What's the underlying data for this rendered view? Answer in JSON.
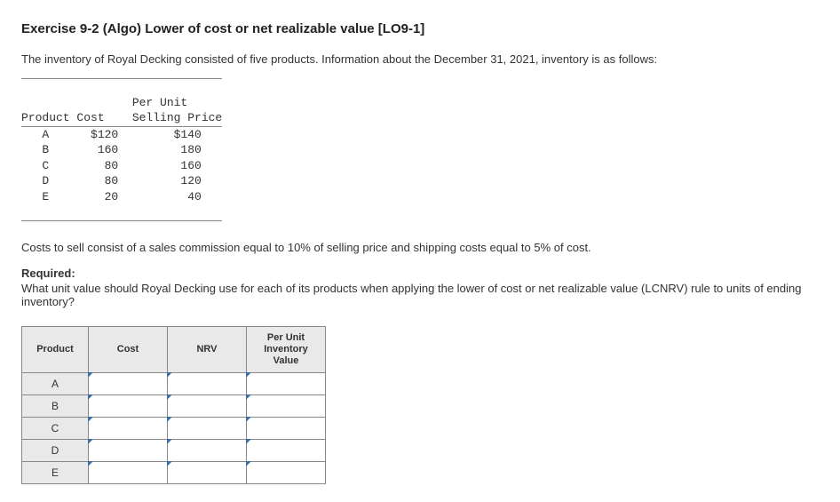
{
  "title": "Exercise 9-2 (Algo) Lower of cost or net realizable value [LO9-1]",
  "intro": "The inventory of Royal Decking consisted of five products. Information about the December 31, 2021, inventory is as follows:",
  "data_table": {
    "per_unit_label": "Per Unit",
    "headers": {
      "product": "Product",
      "cost": "Cost",
      "selling_price": "Selling Price"
    },
    "rows": [
      {
        "product": "A",
        "cost": "$120",
        "selling_price": "$140"
      },
      {
        "product": "B",
        "cost": "160",
        "selling_price": "180"
      },
      {
        "product": "C",
        "cost": "80",
        "selling_price": "160"
      },
      {
        "product": "D",
        "cost": "80",
        "selling_price": "120"
      },
      {
        "product": "E",
        "cost": "20",
        "selling_price": "40"
      }
    ]
  },
  "costs_note": "Costs to sell consist of a sales commission equal to 10% of selling price and shipping costs equal to 5% of cost.",
  "required_label": "Required:",
  "required_text": "What unit value should Royal Decking use for each of its products when applying the lower of cost or net realizable value (LCNRV) rule to units of ending inventory?",
  "answer_table": {
    "headers": {
      "product": "Product",
      "cost": "Cost",
      "nrv": "NRV",
      "inv": "Per Unit Inventory Value"
    },
    "rows": [
      "A",
      "B",
      "C",
      "D",
      "E"
    ]
  }
}
